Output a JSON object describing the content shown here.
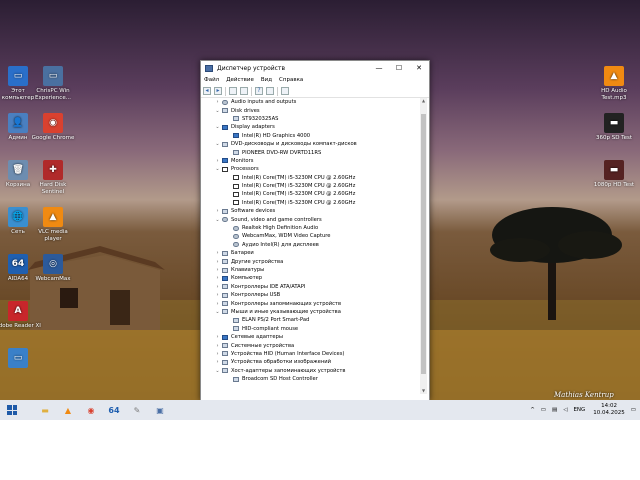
{
  "desktop": {
    "icons_left": [
      {
        "label": "Этот компьютер",
        "glyph": "▭",
        "color": "#2a6fc9",
        "icon": "computer-icon"
      },
      {
        "label": "Админ",
        "glyph": "👤",
        "color": "#4a7fc0",
        "icon": "user-folder-icon"
      },
      {
        "label": "Корзина",
        "glyph": "🗑",
        "color": "#6d8db0",
        "icon": "recycle-bin-icon"
      },
      {
        "label": "Сеть",
        "glyph": "🌐",
        "color": "#3a8fd0",
        "icon": "network-icon"
      },
      {
        "label": "AIDA64",
        "glyph": "64",
        "color": "#1f5fb0",
        "icon": "aida64-icon"
      },
      {
        "label": "Adobe Reader XI",
        "glyph": "A",
        "color": "#c8262b",
        "icon": "adobe-reader-icon"
      },
      {
        "label": "",
        "glyph": "▭",
        "color": "#3a80c8",
        "icon": "desktop-shortcut-icon"
      }
    ],
    "icons_col2": [
      {
        "label": "ChrisPC Win Experience...",
        "glyph": "▭",
        "color": "#4a70a0",
        "icon": "chrispc-icon"
      },
      {
        "label": "Google Chrome",
        "glyph": "◉",
        "color": "#d9412f",
        "icon": "chrome-icon"
      },
      {
        "label": "Hard Disk Sentinel",
        "glyph": "✚",
        "color": "#b02a2a",
        "icon": "hard-disk-sentinel-icon"
      },
      {
        "label": "VLC media player",
        "glyph": "▲",
        "color": "#f08a12",
        "icon": "vlc-icon"
      },
      {
        "label": "WebcamMax",
        "glyph": "◎",
        "color": "#2c5a9a",
        "icon": "webcammax-icon"
      }
    ],
    "icons_right": [
      {
        "label": "HD Audio Test.mp3",
        "glyph": "▲",
        "color": "#f08a12",
        "icon": "vlc-file-icon"
      },
      {
        "label": "360p SD Test",
        "glyph": "▬",
        "color": "#222",
        "icon": "video-file-icon"
      },
      {
        "label": "1080p HD Test",
        "glyph": "▬",
        "color": "#552222",
        "icon": "video-file-icon"
      }
    ],
    "photo_credit": "Mathias Kentrup"
  },
  "window": {
    "title": "Диспетчер устройств",
    "controls": {
      "minimize": "—",
      "maximize": "☐",
      "close": "✕"
    },
    "menu": [
      "Файл",
      "Действие",
      "Вид",
      "Справка"
    ],
    "tree": [
      {
        "level": 1,
        "exp": "›",
        "icon": "audio",
        "label": "Audio inputs and outputs"
      },
      {
        "level": 1,
        "exp": "⌄",
        "icon": "disk",
        "label": "Disk drives"
      },
      {
        "level": 2,
        "exp": "",
        "icon": "disk",
        "label": "ST9320325AS"
      },
      {
        "level": 1,
        "exp": "⌄",
        "icon": "disp",
        "label": "Display adapters"
      },
      {
        "level": 2,
        "exp": "",
        "icon": "disp",
        "label": "Intel(R) HD Graphics 4000"
      },
      {
        "level": 1,
        "exp": "⌄",
        "icon": "disk",
        "label": "DVD-дисководы и дисководы компакт-дисков"
      },
      {
        "level": 2,
        "exp": "",
        "icon": "disk",
        "label": "PIONEER DVD-RW DVRTD11RS"
      },
      {
        "level": 1,
        "exp": "›",
        "icon": "disp",
        "label": "Monitors"
      },
      {
        "level": 1,
        "exp": "⌄",
        "icon": "cpu",
        "label": "Processors"
      },
      {
        "level": 2,
        "exp": "",
        "icon": "cpu",
        "label": "Intel(R) Core(TM) i5-3230M CPU @ 2.60GHz"
      },
      {
        "level": 2,
        "exp": "",
        "icon": "cpu",
        "label": "Intel(R) Core(TM) i5-3230M CPU @ 2.60GHz"
      },
      {
        "level": 2,
        "exp": "",
        "icon": "cpu",
        "label": "Intel(R) Core(TM) i5-3230M CPU @ 2.60GHz"
      },
      {
        "level": 2,
        "exp": "",
        "icon": "cpu",
        "label": "Intel(R) Core(TM) i5-3230M CPU @ 2.60GHz"
      },
      {
        "level": 1,
        "exp": "›",
        "icon": "disk",
        "label": "Software devices"
      },
      {
        "level": 1,
        "exp": "⌄",
        "icon": "audio",
        "label": "Sound, video and game controllers"
      },
      {
        "level": 2,
        "exp": "",
        "icon": "audio",
        "label": "Realtek High Definition Audio"
      },
      {
        "level": 2,
        "exp": "",
        "icon": "audio",
        "label": "WebcamMax, WDM Video Capture"
      },
      {
        "level": 2,
        "exp": "",
        "icon": "audio",
        "label": "Аудио Intel(R) для дисплеев"
      },
      {
        "level": 1,
        "exp": "›",
        "icon": "disk",
        "label": "Батареи"
      },
      {
        "level": 1,
        "exp": "›",
        "icon": "disk",
        "label": "Другие устройства"
      },
      {
        "level": 1,
        "exp": "›",
        "icon": "disk",
        "label": "Клавиатуры"
      },
      {
        "level": 1,
        "exp": "›",
        "icon": "disp",
        "label": "Компьютер"
      },
      {
        "level": 1,
        "exp": "›",
        "icon": "disk",
        "label": "Контроллеры IDE ATA/ATAPI"
      },
      {
        "level": 1,
        "exp": "›",
        "icon": "disk",
        "label": "Контроллеры USB"
      },
      {
        "level": 1,
        "exp": "›",
        "icon": "disk",
        "label": "Контроллеры запоминающих устройств"
      },
      {
        "level": 1,
        "exp": "⌄",
        "icon": "disk",
        "label": "Мыши и иные указывающие устройства"
      },
      {
        "level": 2,
        "exp": "",
        "icon": "disk",
        "label": "ELAN PS/2 Port Smart-Pad"
      },
      {
        "level": 2,
        "exp": "",
        "icon": "disk",
        "label": "HID-compliant mouse"
      },
      {
        "level": 1,
        "exp": "›",
        "icon": "disp",
        "label": "Сетевые адаптеры"
      },
      {
        "level": 1,
        "exp": "›",
        "icon": "disk",
        "label": "Системные устройства"
      },
      {
        "level": 1,
        "exp": "›",
        "icon": "disk",
        "label": "Устройства HID (Human Interface Devices)"
      },
      {
        "level": 1,
        "exp": "›",
        "icon": "disk",
        "label": "Устройства обработки изображений"
      },
      {
        "level": 1,
        "exp": "⌄",
        "icon": "disk",
        "label": "Хост-адаптеры запоминающих устройств"
      },
      {
        "level": 2,
        "exp": "",
        "icon": "disk",
        "label": "Broadcom SD Host Controller"
      }
    ]
  },
  "taskbar": {
    "pinned": [
      {
        "name": "file-explorer",
        "glyph": "▬",
        "color": "#e0b040"
      },
      {
        "name": "vlc",
        "glyph": "▲",
        "color": "#f08a12"
      },
      {
        "name": "chrome",
        "glyph": "◉",
        "color": "#d9412f"
      },
      {
        "name": "aida64",
        "glyph": "64",
        "color": "#1f5fb0"
      },
      {
        "name": "tool",
        "glyph": "✎",
        "color": "#7a7a7a"
      },
      {
        "name": "device-manager",
        "glyph": "▣",
        "color": "#4a6fa5"
      }
    ],
    "tray": {
      "arrow": "^",
      "lang": "ENG",
      "time": "14:02",
      "date": "10.04.2025"
    }
  }
}
